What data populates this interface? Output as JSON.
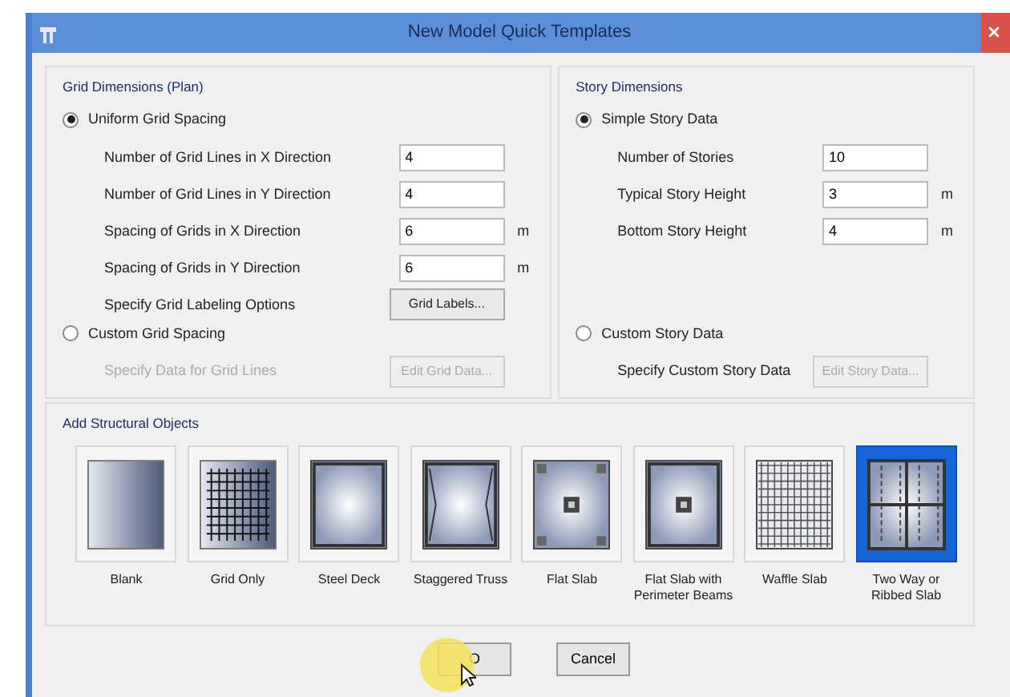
{
  "window": {
    "title": "New Model Quick Templates"
  },
  "panels": [
    {
      "title": "Grid Dimensions (Plan)",
      "options": [
        {
          "label": "Uniform Grid Spacing",
          "selected": true,
          "rows": [
            {
              "kind": "field",
              "label": "Number of Grid Lines in X Direction",
              "value": "4"
            },
            {
              "kind": "field",
              "label": "Number of Grid Lines in Y Direction",
              "value": "4"
            },
            {
              "kind": "field",
              "label": "Spacing of Grids in X Direction",
              "value": "6",
              "unit": "m"
            },
            {
              "kind": "field",
              "label": "Spacing of Grids in Y Direction",
              "value": "6",
              "unit": "m"
            },
            {
              "kind": "button",
              "label": "Specify Grid Labeling Options",
              "button": "Grid Labels...",
              "disabled": false,
              "label_disabled": false
            }
          ]
        },
        {
          "label": "Custom Grid Spacing",
          "selected": false,
          "rows": [
            {
              "kind": "button",
              "label": "Specify Data for Grid Lines",
              "button": "Edit Grid Data...",
              "disabled": true,
              "label_disabled": true
            }
          ]
        }
      ]
    },
    {
      "title": "Story Dimensions",
      "options": [
        {
          "label": "Simple Story Data",
          "selected": true,
          "rows": [
            {
              "kind": "field",
              "label": "Number of Stories",
              "value": "10"
            },
            {
              "kind": "field",
              "label": "Typical Story Height",
              "value": "3",
              "unit": "m"
            },
            {
              "kind": "field",
              "label": "Bottom Story Height",
              "value": "4",
              "unit": "m"
            }
          ]
        },
        {
          "label": "Custom Story Data",
          "selected": false,
          "rows": [
            {
              "kind": "button",
              "label": "Specify Custom Story Data",
              "button": "Edit Story Data...",
              "disabled": true,
              "label_disabled": false
            }
          ]
        }
      ]
    }
  ],
  "structural_objects": {
    "title": "Add Structural Objects",
    "templates": [
      {
        "kind": "blank",
        "label": "Blank",
        "selected": false
      },
      {
        "kind": "grid",
        "label": "Grid Only",
        "selected": false
      },
      {
        "kind": "steel",
        "label": "Steel Deck",
        "selected": false
      },
      {
        "kind": "truss",
        "label": "Staggered Truss",
        "selected": false
      },
      {
        "kind": "flat",
        "label": "Flat Slab",
        "selected": false
      },
      {
        "kind": "flatbeams",
        "label": "Flat Slab with Perimeter Beams",
        "selected": false
      },
      {
        "kind": "waffle",
        "label": "Waffle Slab",
        "selected": false
      },
      {
        "kind": "ribbed",
        "label": "Two Way or Ribbed Slab",
        "selected": true
      }
    ]
  },
  "buttons": [
    {
      "label": "O"
    },
    {
      "label": "Cancel"
    }
  ]
}
